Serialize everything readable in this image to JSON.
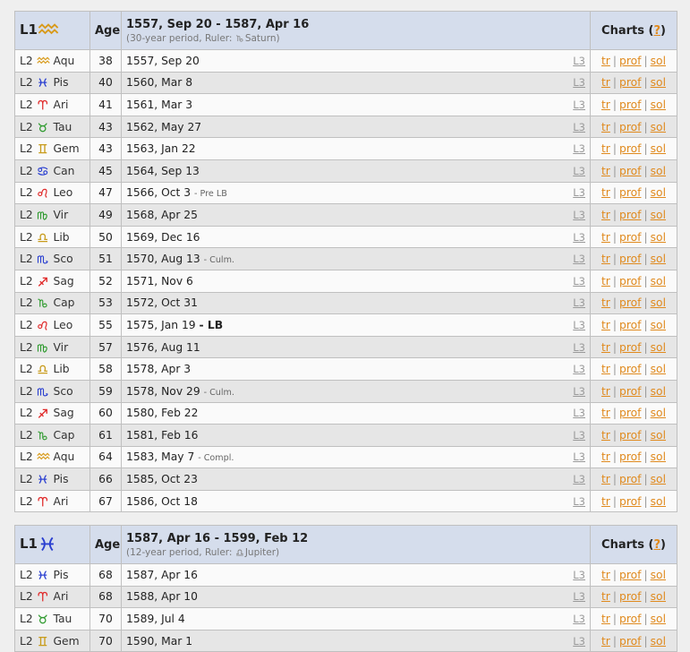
{
  "colors": {
    "aqu": "#d89a1a",
    "pis": "#2a3fd0",
    "ari": "#e02b2b",
    "tau": "#2e9a2e",
    "gem": "#c89b1b",
    "can": "#2a3fd0",
    "leo": "#e02b2b",
    "vir": "#2e9a2e",
    "lib": "#c89b1b",
    "sco": "#2a3fd0",
    "sag": "#e02b2b",
    "cap": "#2e9a2e",
    "link": "#e08a1e",
    "header_bg": "#d5ddec"
  },
  "headers": {
    "age": "Age",
    "charts": "Charts",
    "help": "?",
    "l2": "L2",
    "l3": "L3",
    "link_tr": "tr",
    "link_prof": "prof",
    "link_sol": "sol",
    "pipe": "|"
  },
  "tables": [
    {
      "l1": "L1",
      "l1_sign": "aqu",
      "period": "1557, Sep 20 - 1587, Apr 16",
      "subtitle_pre": "(30-year period, Ruler:",
      "ruler_sign": "cap",
      "ruler": "Saturn)",
      "rows": [
        {
          "sign": "aqu",
          "abbr": "Aqu",
          "age": "38",
          "date": "1557, Sep 20",
          "note": "",
          "lb": ""
        },
        {
          "sign": "pis",
          "abbr": "Pis",
          "age": "40",
          "date": "1560, Mar 8",
          "note": "",
          "lb": ""
        },
        {
          "sign": "ari",
          "abbr": "Ari",
          "age": "41",
          "date": "1561, Mar 3",
          "note": "",
          "lb": ""
        },
        {
          "sign": "tau",
          "abbr": "Tau",
          "age": "43",
          "date": "1562, May 27",
          "note": "",
          "lb": ""
        },
        {
          "sign": "gem",
          "abbr": "Gem",
          "age": "43",
          "date": "1563, Jan 22",
          "note": "",
          "lb": ""
        },
        {
          "sign": "can",
          "abbr": "Can",
          "age": "45",
          "date": "1564, Sep 13",
          "note": "",
          "lb": ""
        },
        {
          "sign": "leo",
          "abbr": "Leo",
          "age": "47",
          "date": "1566, Oct 3",
          "note": "- Pre LB",
          "lb": ""
        },
        {
          "sign": "vir",
          "abbr": "Vir",
          "age": "49",
          "date": "1568, Apr 25",
          "note": "",
          "lb": ""
        },
        {
          "sign": "lib",
          "abbr": "Lib",
          "age": "50",
          "date": "1569, Dec 16",
          "note": "",
          "lb": ""
        },
        {
          "sign": "sco",
          "abbr": "Sco",
          "age": "51",
          "date": "1570, Aug 13",
          "note": "- Culm.",
          "lb": ""
        },
        {
          "sign": "sag",
          "abbr": "Sag",
          "age": "52",
          "date": "1571, Nov 6",
          "note": "",
          "lb": ""
        },
        {
          "sign": "cap",
          "abbr": "Cap",
          "age": "53",
          "date": "1572, Oct 31",
          "note": "",
          "lb": ""
        },
        {
          "sign": "leo",
          "abbr": "Leo",
          "age": "55",
          "date": "1575, Jan 19",
          "note": "",
          "lb": "- LB"
        },
        {
          "sign": "vir",
          "abbr": "Vir",
          "age": "57",
          "date": "1576, Aug 11",
          "note": "",
          "lb": ""
        },
        {
          "sign": "lib",
          "abbr": "Lib",
          "age": "58",
          "date": "1578, Apr 3",
          "note": "",
          "lb": ""
        },
        {
          "sign": "sco",
          "abbr": "Sco",
          "age": "59",
          "date": "1578, Nov 29",
          "note": "- Culm.",
          "lb": ""
        },
        {
          "sign": "sag",
          "abbr": "Sag",
          "age": "60",
          "date": "1580, Feb 22",
          "note": "",
          "lb": ""
        },
        {
          "sign": "cap",
          "abbr": "Cap",
          "age": "61",
          "date": "1581, Feb 16",
          "note": "",
          "lb": ""
        },
        {
          "sign": "aqu",
          "abbr": "Aqu",
          "age": "64",
          "date": "1583, May 7",
          "note": "- Compl.",
          "lb": ""
        },
        {
          "sign": "pis",
          "abbr": "Pis",
          "age": "66",
          "date": "1585, Oct 23",
          "note": "",
          "lb": ""
        },
        {
          "sign": "ari",
          "abbr": "Ari",
          "age": "67",
          "date": "1586, Oct 18",
          "note": "",
          "lb": ""
        }
      ]
    },
    {
      "l1": "L1",
      "l1_sign": "pis",
      "period": "1587, Apr 16 - 1599, Feb 12",
      "subtitle_pre": "(12-year period, Ruler:",
      "ruler_sign": "lib",
      "ruler": "Jupiter)",
      "rows": [
        {
          "sign": "pis",
          "abbr": "Pis",
          "age": "68",
          "date": "1587, Apr 16",
          "note": "",
          "lb": ""
        },
        {
          "sign": "ari",
          "abbr": "Ari",
          "age": "68",
          "date": "1588, Apr 10",
          "note": "",
          "lb": ""
        },
        {
          "sign": "tau",
          "abbr": "Tau",
          "age": "70",
          "date": "1589, Jul 4",
          "note": "",
          "lb": ""
        },
        {
          "sign": "gem",
          "abbr": "Gem",
          "age": "70",
          "date": "1590, Mar 1",
          "note": "",
          "lb": ""
        }
      ]
    }
  ]
}
